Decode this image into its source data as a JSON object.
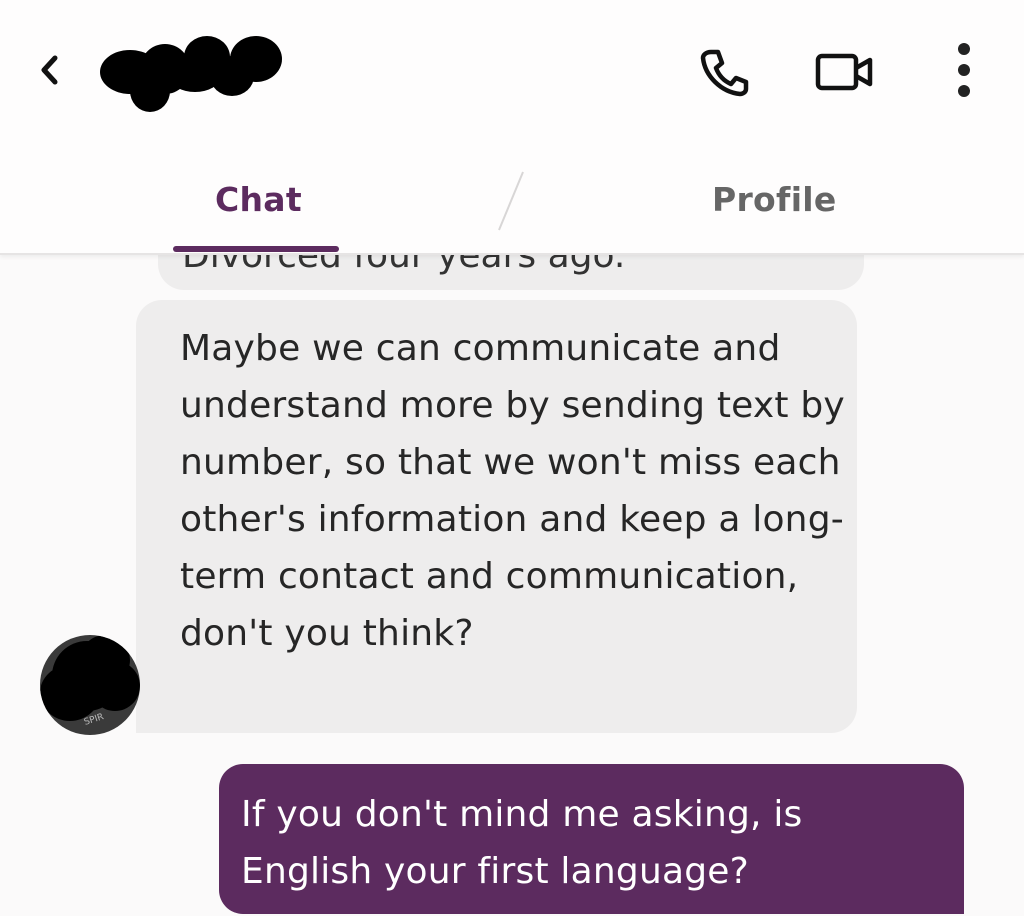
{
  "header": {
    "back_icon": "chevron-left-icon",
    "contact_name": "",
    "call_icon": "phone-icon",
    "video_icon": "video-camera-icon",
    "more_icon": "more-vertical-icon"
  },
  "tabs": [
    {
      "label": "Chat",
      "active": true
    },
    {
      "label": "Profile",
      "active": false
    }
  ],
  "colors": {
    "accent": "#5c2b5f",
    "incoming_bubble": "#eeeded",
    "outgoing_bubble": "#5c2b5f",
    "background": "#fbfafa"
  },
  "messages": [
    {
      "direction": "incoming",
      "text": "Divorced four years ago.",
      "partial": true
    },
    {
      "direction": "incoming",
      "text": "Maybe we can communicate and understand more by sending text by number, so that we won't miss each other's information and keep a long-term contact and communication, don't you think?"
    },
    {
      "direction": "outgoing",
      "text": "If you don't mind me asking, is English your first language?"
    }
  ],
  "avatar": {
    "shirt_text": "SPIR"
  }
}
